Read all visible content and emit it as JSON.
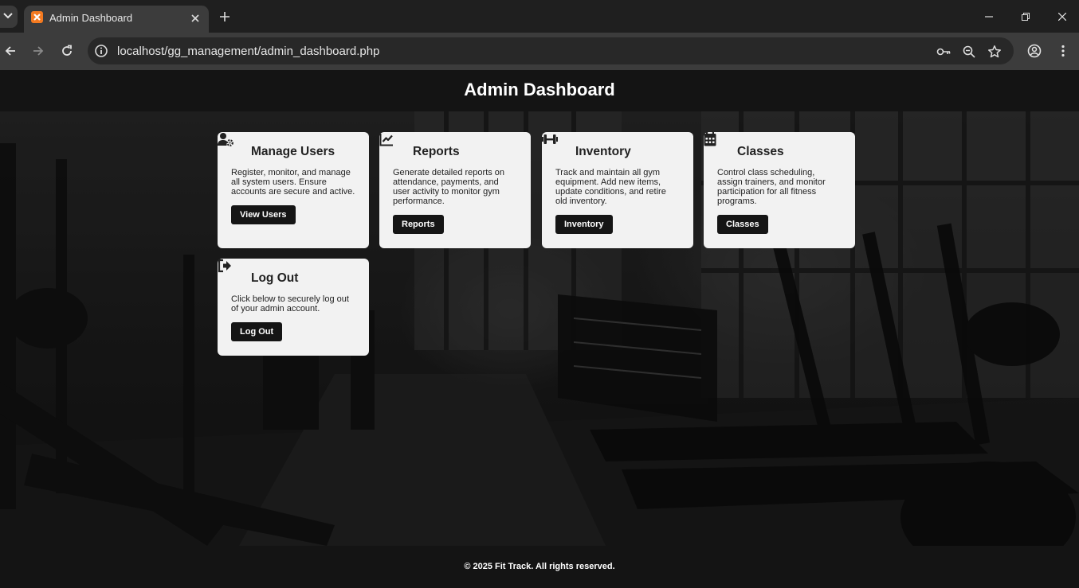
{
  "browser": {
    "tab_title": "Admin Dashboard",
    "url": "localhost/gg_management/admin_dashboard.php"
  },
  "header": {
    "title": "Admin Dashboard"
  },
  "cards": [
    {
      "title": "Manage Users",
      "icon": "user-gear-icon",
      "description": "Register, monitor, and manage all system users. Ensure accounts are secure and active.",
      "button": "View Users"
    },
    {
      "title": "Reports",
      "icon": "chart-line-icon",
      "description": "Generate detailed reports on attendance, payments, and user activity to monitor gym performance.",
      "button": "Reports"
    },
    {
      "title": "Inventory",
      "icon": "dumbbell-icon",
      "description": "Track and maintain all gym equipment. Add new items, update conditions, and retire old inventory.",
      "button": "Inventory"
    },
    {
      "title": "Classes",
      "icon": "calendar-icon",
      "description": "Control class scheduling, assign trainers, and monitor participation for all fitness programs.",
      "button": "Classes"
    },
    {
      "title": "Log Out",
      "icon": "sign-out-icon",
      "description": "Click below to securely log out of your admin account.",
      "button": "Log Out"
    }
  ],
  "footer": {
    "text": "© 2025 Fit Track. All rights reserved."
  }
}
